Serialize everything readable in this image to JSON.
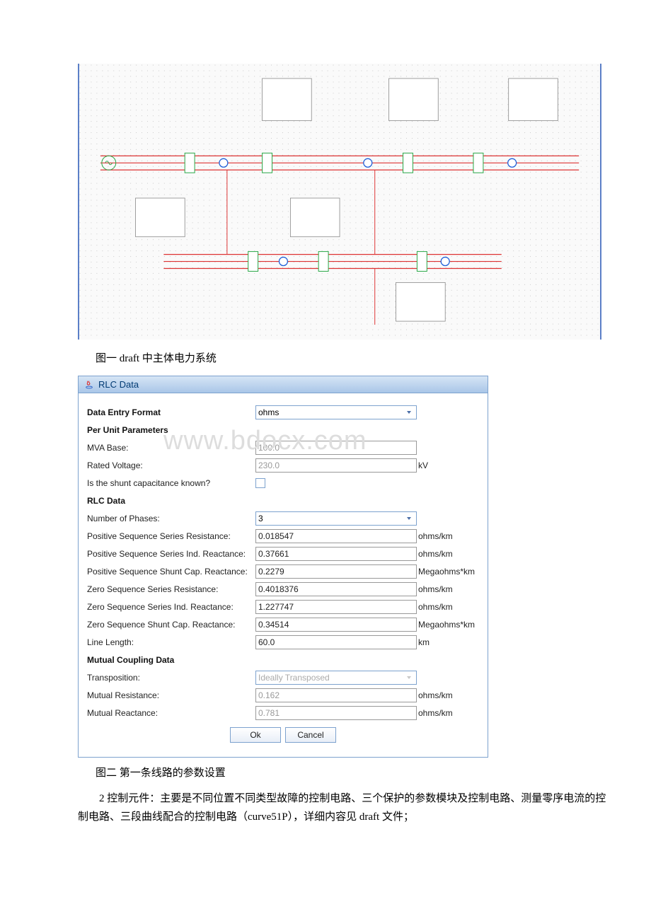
{
  "captions": {
    "fig1": "图一 draft 中主体电力系统",
    "fig2": "图二 第一条线路的参数设置"
  },
  "dialog": {
    "title": "RLC Data",
    "section1": "Data Entry Format",
    "data_entry_format": "ohms",
    "section2": "Per Unit Parameters",
    "mva_base_label": "MVA Base:",
    "mva_base_value": "100.0",
    "rated_voltage_label": "Rated Voltage:",
    "rated_voltage_value": "230.0",
    "rated_voltage_unit": "kV",
    "shunt_cap_known_label": "Is the shunt capacitance known?",
    "section3": "RLC Data",
    "phases_label": "Number of Phases:",
    "phases_value": "3",
    "pos_r_label": "Positive Sequence Series Resistance:",
    "pos_r_value": "0.018547",
    "pos_r_unit": "ohms/km",
    "pos_x_label": "Positive Sequence Series Ind. Reactance:",
    "pos_x_value": "0.37661",
    "pos_x_unit": "ohms/km",
    "pos_c_label": "Positive Sequence Shunt Cap. Reactance:",
    "pos_c_value": "0.2279",
    "pos_c_unit": "Megaohms*km",
    "zero_r_label": "Zero Sequence Series Resistance:",
    "zero_r_value": "0.4018376",
    "zero_r_unit": "ohms/km",
    "zero_x_label": "Zero Sequence Series Ind. Reactance:",
    "zero_x_value": "1.227747",
    "zero_x_unit": "ohms/km",
    "zero_c_label": "Zero Sequence Shunt Cap. Reactance:",
    "zero_c_value": "0.34514",
    "zero_c_unit": "Megaohms*km",
    "length_label": "Line Length:",
    "length_value": "60.0",
    "length_unit": "km",
    "section4": "Mutual Coupling Data",
    "transposition_label": "Transposition:",
    "transposition_value": "Ideally Transposed",
    "mutual_r_label": "Mutual Resistance:",
    "mutual_r_value": "0.162",
    "mutual_r_unit": "ohms/km",
    "mutual_x_label": "Mutual Reactance:",
    "mutual_x_value": "0.781",
    "mutual_x_unit": "ohms/km",
    "ok": "Ok",
    "cancel": "Cancel"
  },
  "watermark": "www.bdocx.com",
  "prose": "2 控制元件：主要是不同位置不同类型故障的控制电路、三个保护的参数模块及控制电路、测量零序电流的控制电路、三段曲线配合的控制电路（curve51P），详细内容见 draft 文件；"
}
